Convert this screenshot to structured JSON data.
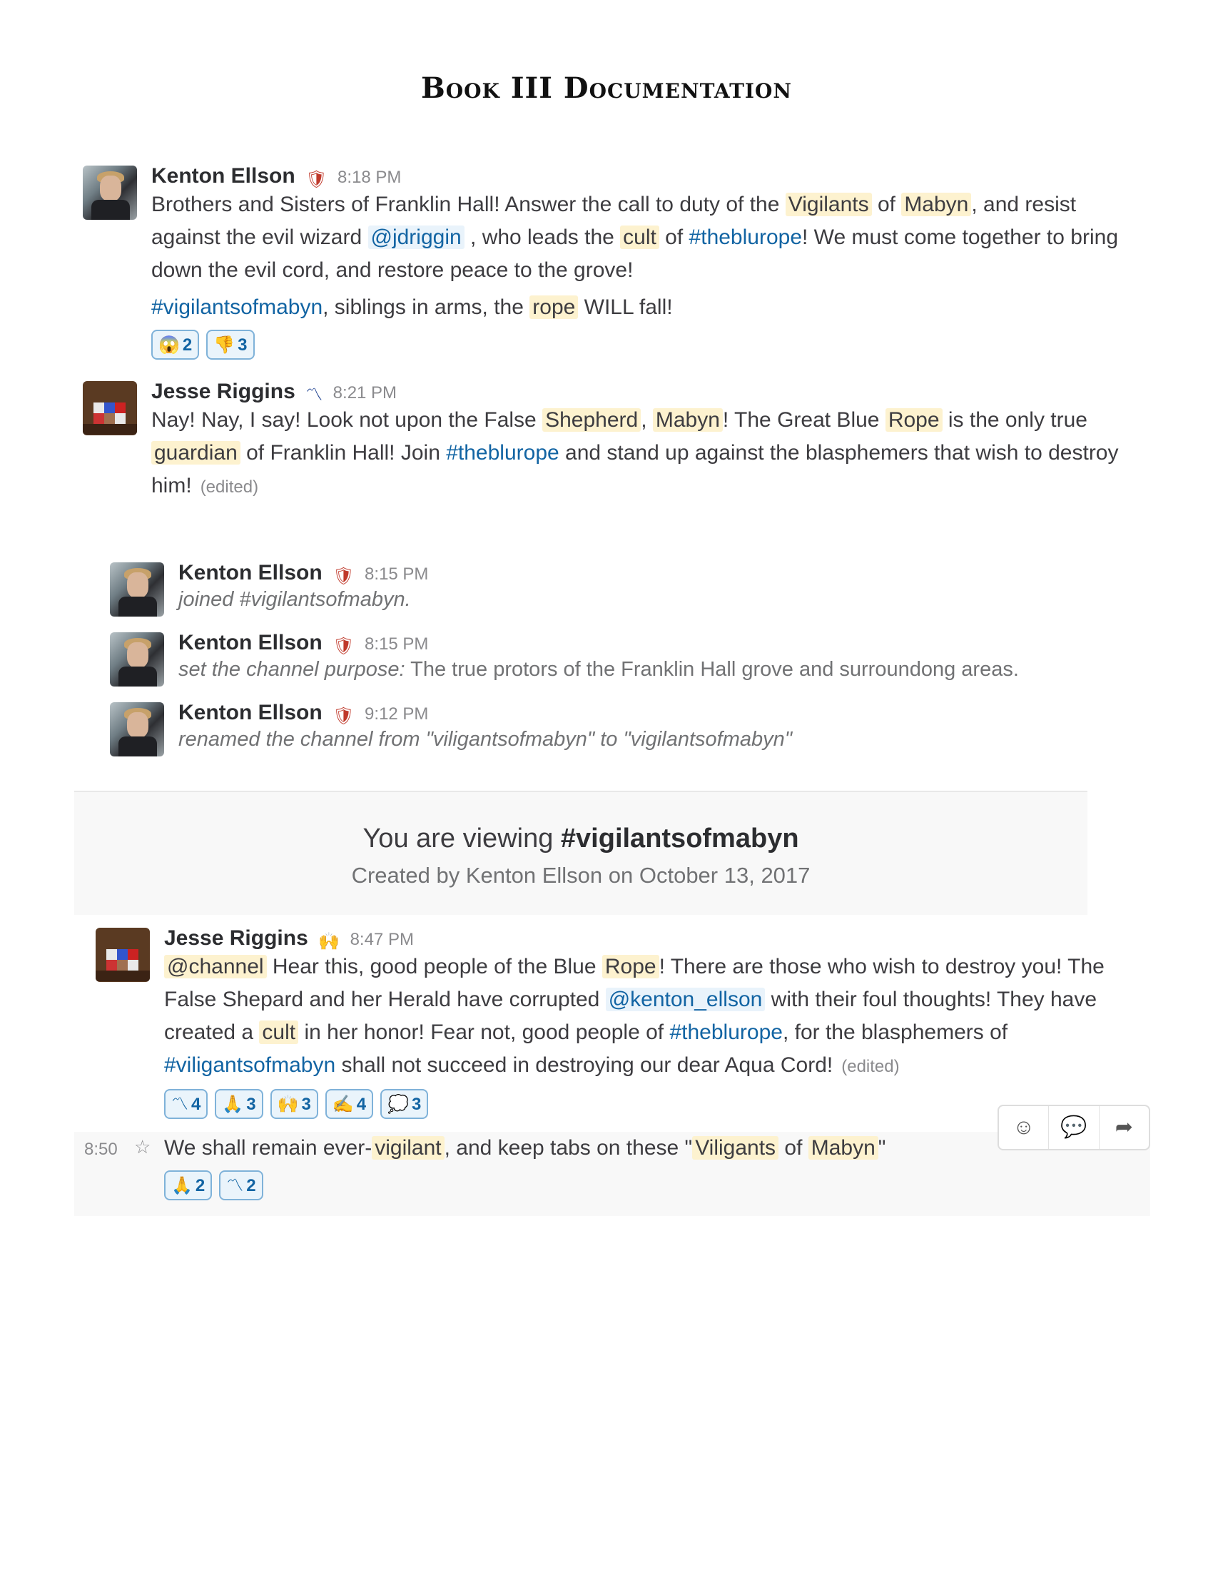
{
  "document": {
    "title": "Book III Documentation"
  },
  "messages": [
    {
      "author": "Kenton Ellson",
      "badge": "shield-icon",
      "time": "8:18 PM",
      "p1": {
        "a": "Brothers and Sisters of Franklin Hall! Answer the call to duty of the ",
        "hl1": "Vigilants",
        "b": " of ",
        "hl2": "Mabyn",
        "c": ", and resist against the evil wizard ",
        "mention": "@jdriggin",
        "d": " , who leads the ",
        "hl3": "cult",
        "e": " of ",
        "chan": "#theblurope",
        "f": "! We must come together to bring down the evil cord, and restore peace to the grove!"
      },
      "p2": {
        "chan": "#vigilantsofmabyn",
        "a": ", siblings in arms, the ",
        "hl": "rope",
        "b": " WILL fall!"
      },
      "reactions": [
        {
          "icon": "😱",
          "count": "2"
        },
        {
          "icon": "👎",
          "count": "3"
        }
      ]
    },
    {
      "author": "Jesse Riggins",
      "badge": "rope-icon",
      "time": "8:21 PM",
      "p1": {
        "a": "Nay! Nay, I say! Look not upon the False ",
        "hl1": "Shepherd",
        "b": ", ",
        "hl2": "Mabyn",
        "c": "! The Great Blue ",
        "hl3": "Rope",
        "d": " is the only true ",
        "hl4": "guardian",
        "e": " of Franklin Hall! Join ",
        "chan": "#theblurope",
        "f": " and stand up against the blasphemers that wish to destroy him!"
      },
      "edited": "(edited)"
    }
  ],
  "system_messages": [
    {
      "author": "Kenton Ellson",
      "time": "8:15 PM",
      "text": "joined #vigilantsofmabyn."
    },
    {
      "author": "Kenton Ellson",
      "time": "8:15 PM",
      "italic": "set the channel purpose:",
      "plain": " The true protors of the Franklin Hall grove and surroundong areas."
    },
    {
      "author": "Kenton Ellson",
      "time": "9:12 PM",
      "text": "renamed the channel from \"viligantsofmabyn\" to \"vigilantsofmabyn\""
    }
  ],
  "banner": {
    "prefix": "You are viewing ",
    "channel": "#vigilantsofmabyn",
    "created": "Created by Kenton Ellson on October 13, 2017"
  },
  "final_message": {
    "author": "Jesse Riggins",
    "badge": "raised-hands-icon",
    "time": "8:47 PM",
    "p1": {
      "cm": "@channel",
      "a": " Hear this, good people of the Blue ",
      "hl1": "Rope",
      "b": "! There are those who wish to destroy you! The False Shepard and her Herald have corrupted ",
      "mention": "@kenton_ellson",
      "c": " with their foul thoughts! They have created a ",
      "hl2": "cult",
      "d": " in her honor! Fear not, good people of ",
      "chan1": "#theblurope",
      "e": ", for the blasphemers of ",
      "chan2": "#viligantsofmabyn",
      "f": " shall not succeed in destroying our dear Aqua Cord!"
    },
    "edited": "(edited)",
    "reactions": [
      {
        "icon": "〽",
        "count": "4"
      },
      {
        "icon": "🙏",
        "count": "3"
      },
      {
        "icon": "🙌",
        "count": "3"
      },
      {
        "icon": "✍",
        "count": "4"
      },
      {
        "icon": "💭",
        "count": "3"
      }
    ]
  },
  "followup": {
    "time": "8:50",
    "p": {
      "a": "We shall remain ever-",
      "hl1": "vigilant",
      "b": ", and keep tabs on these \"",
      "hl2": "Viligants",
      "c": " of ",
      "hl3": "Mabyn",
      "d": "\""
    },
    "reactions": [
      {
        "icon": "🙏",
        "count": "2"
      },
      {
        "icon": "〽",
        "count": "2"
      }
    ]
  },
  "actions": [
    "add-reaction-icon",
    "start-thread-icon",
    "share-message-icon"
  ]
}
